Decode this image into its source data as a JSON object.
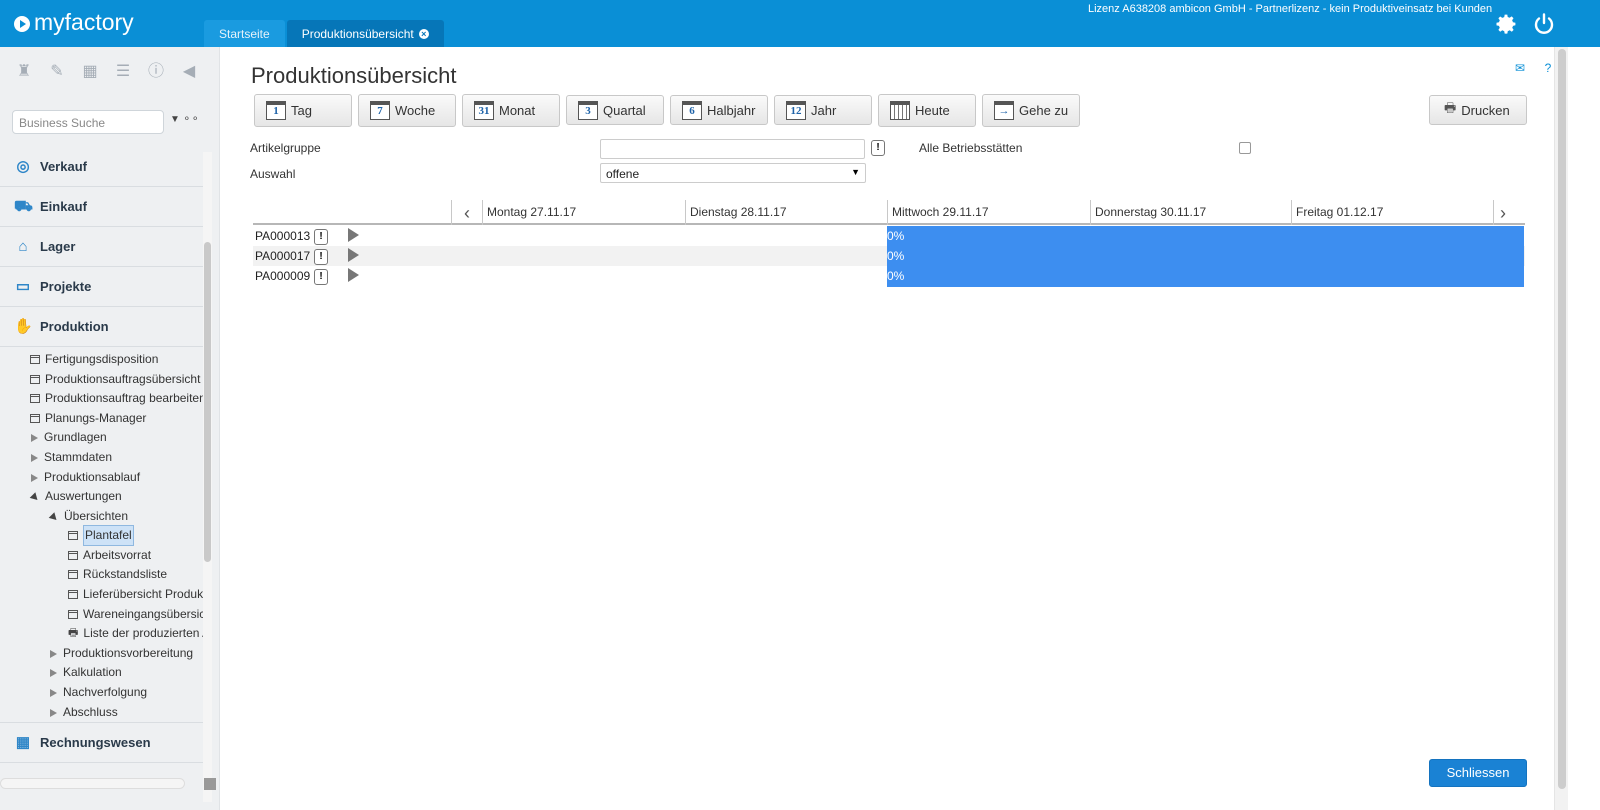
{
  "app": {
    "brand": "myfactory",
    "license": "Lizenz A638208 ambicon GmbH - Partnerlizenz - kein Produktiveinsatz bei Kunden",
    "accent_color": "#0a8fd6"
  },
  "tabs": [
    {
      "label": "Startseite",
      "active": false
    },
    {
      "label": "Produktionsübersicht",
      "active": true,
      "close": "×"
    }
  ],
  "top_icons": [
    "gear-icon",
    "power-icon"
  ],
  "sidebar": {
    "tools": [
      "pin-icon",
      "eraser-icon",
      "calendar-icon",
      "notes-icon",
      "info-icon",
      "collapse-icon"
    ],
    "search_placeholder": "Business Suche",
    "nav": [
      {
        "label": "Verkauf",
        "icon": "coins-icon"
      },
      {
        "label": "Einkauf",
        "icon": "cart-icon"
      },
      {
        "label": "Lager",
        "icon": "warehouse-icon"
      },
      {
        "label": "Projekte",
        "icon": "presentation-icon"
      },
      {
        "label": "Produktion",
        "icon": "production-icon"
      }
    ],
    "tree": [
      {
        "label": "Fertigungsdisposition",
        "kind": "page",
        "indent": 0
      },
      {
        "label": "Produktionsauftragsübersicht",
        "kind": "page",
        "indent": 0
      },
      {
        "label": "Produktionsauftrag bearbeiten",
        "kind": "page",
        "indent": 0
      },
      {
        "label": "Planungs-Manager",
        "kind": "page",
        "indent": 0
      },
      {
        "label": "Grundlagen",
        "kind": "closed",
        "indent": 0
      },
      {
        "label": "Stammdaten",
        "kind": "closed",
        "indent": 0
      },
      {
        "label": "Produktionsablauf",
        "kind": "closed",
        "indent": 0
      },
      {
        "label": "Auswertungen",
        "kind": "open",
        "indent": 0
      },
      {
        "label": "Übersichten",
        "kind": "open",
        "indent": 1
      },
      {
        "label": "Plantafel",
        "kind": "page",
        "indent": 2,
        "selected": true
      },
      {
        "label": "Arbeitsvorrat",
        "kind": "page",
        "indent": 2
      },
      {
        "label": "Rückstandsliste",
        "kind": "page",
        "indent": 2
      },
      {
        "label": "Lieferübersicht Produkt",
        "kind": "page",
        "indent": 2
      },
      {
        "label": "Wareneingangsübersich",
        "kind": "page",
        "indent": 2
      },
      {
        "label": "Liste der produzierten A",
        "kind": "print",
        "indent": 2
      },
      {
        "label": "Produktionsvorbereitung",
        "kind": "closed",
        "indent": 1
      },
      {
        "label": "Kalkulation",
        "kind": "closed",
        "indent": 1
      },
      {
        "label": "Nachverfolgung",
        "kind": "closed",
        "indent": 1
      },
      {
        "label": "Abschluss",
        "kind": "closed",
        "indent": 1
      }
    ],
    "nav_bottom": {
      "label": "Rechnungswesen",
      "icon": "grid-icon"
    }
  },
  "main": {
    "title": "Produktionsübersicht",
    "buttons": [
      {
        "label": "Tag",
        "cal": "1"
      },
      {
        "label": "Woche",
        "cal": "7"
      },
      {
        "label": "Monat",
        "cal": "31"
      },
      {
        "label": "Quartal",
        "cal": "3"
      },
      {
        "label": "Halbjahr",
        "cal": "6"
      },
      {
        "label": "Jahr",
        "cal": "12"
      },
      {
        "label": "Heute",
        "cal": ""
      },
      {
        "label": "Gehe zu",
        "cal": "→"
      }
    ],
    "print_label": "Drucken",
    "artikelgruppe_label": "Artikelgruppe",
    "artikelgruppe_value": "",
    "auswahl_label": "Auswahl",
    "auswahl_value": "offene",
    "betriebsstaetten_label": "Alle Betriebsstätten",
    "betriebsstaetten_checked": false,
    "warn": "!",
    "close_label": "Schliessen"
  },
  "gantt": {
    "days": [
      "Montag 27.11.17",
      "Dienstag 28.11.17",
      "Mittwoch 29.11.17",
      "Donnerstag 30.11.17",
      "Freitag 01.12.17"
    ],
    "rows": [
      {
        "id": "PA000013",
        "progress": "0%"
      },
      {
        "id": "PA000017",
        "progress": "0%"
      },
      {
        "id": "PA000009",
        "progress": "0%"
      }
    ],
    "bar_color": "#3d8ef0"
  }
}
